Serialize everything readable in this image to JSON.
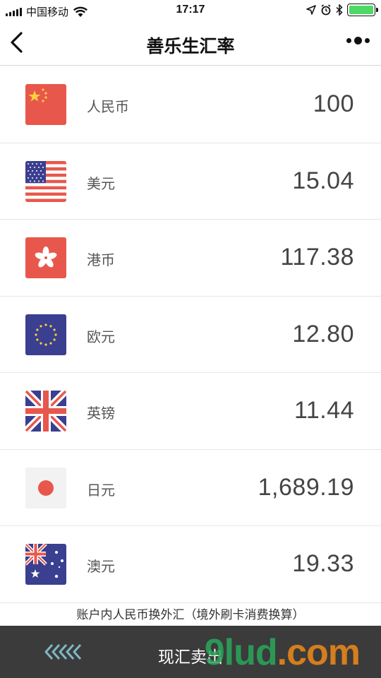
{
  "status_bar": {
    "carrier": "中国移动",
    "time": "17:17",
    "battery_level": 1.0
  },
  "nav": {
    "title": "善乐生汇率"
  },
  "currencies": [
    {
      "name": "人民币",
      "value": "100",
      "flag": "cn-flag-icon"
    },
    {
      "name": "美元",
      "value": "15.04",
      "flag": "us-flag-icon"
    },
    {
      "name": "港币",
      "value": "117.38",
      "flag": "hk-flag-icon"
    },
    {
      "name": "欧元",
      "value": "12.80",
      "flag": "eu-flag-icon"
    },
    {
      "name": "英镑",
      "value": "11.44",
      "flag": "uk-flag-icon"
    },
    {
      "name": "日元",
      "value": "1,689.19",
      "flag": "jp-flag-icon"
    },
    {
      "name": "澳元",
      "value": "19.33",
      "flag": "au-flag-icon"
    }
  ],
  "note": "账户内人民币换外汇（境外刷卡消费换算）",
  "bottom_bar": {
    "label": "现汇卖出",
    "watermark_main": "9lud",
    "watermark_dot": ".com"
  },
  "colors": {
    "accent_green": "#4cd964",
    "bottom_bar": "#3b3b3b",
    "flag_red": "#e8574c",
    "flag_blue": "#3b3f8f"
  }
}
